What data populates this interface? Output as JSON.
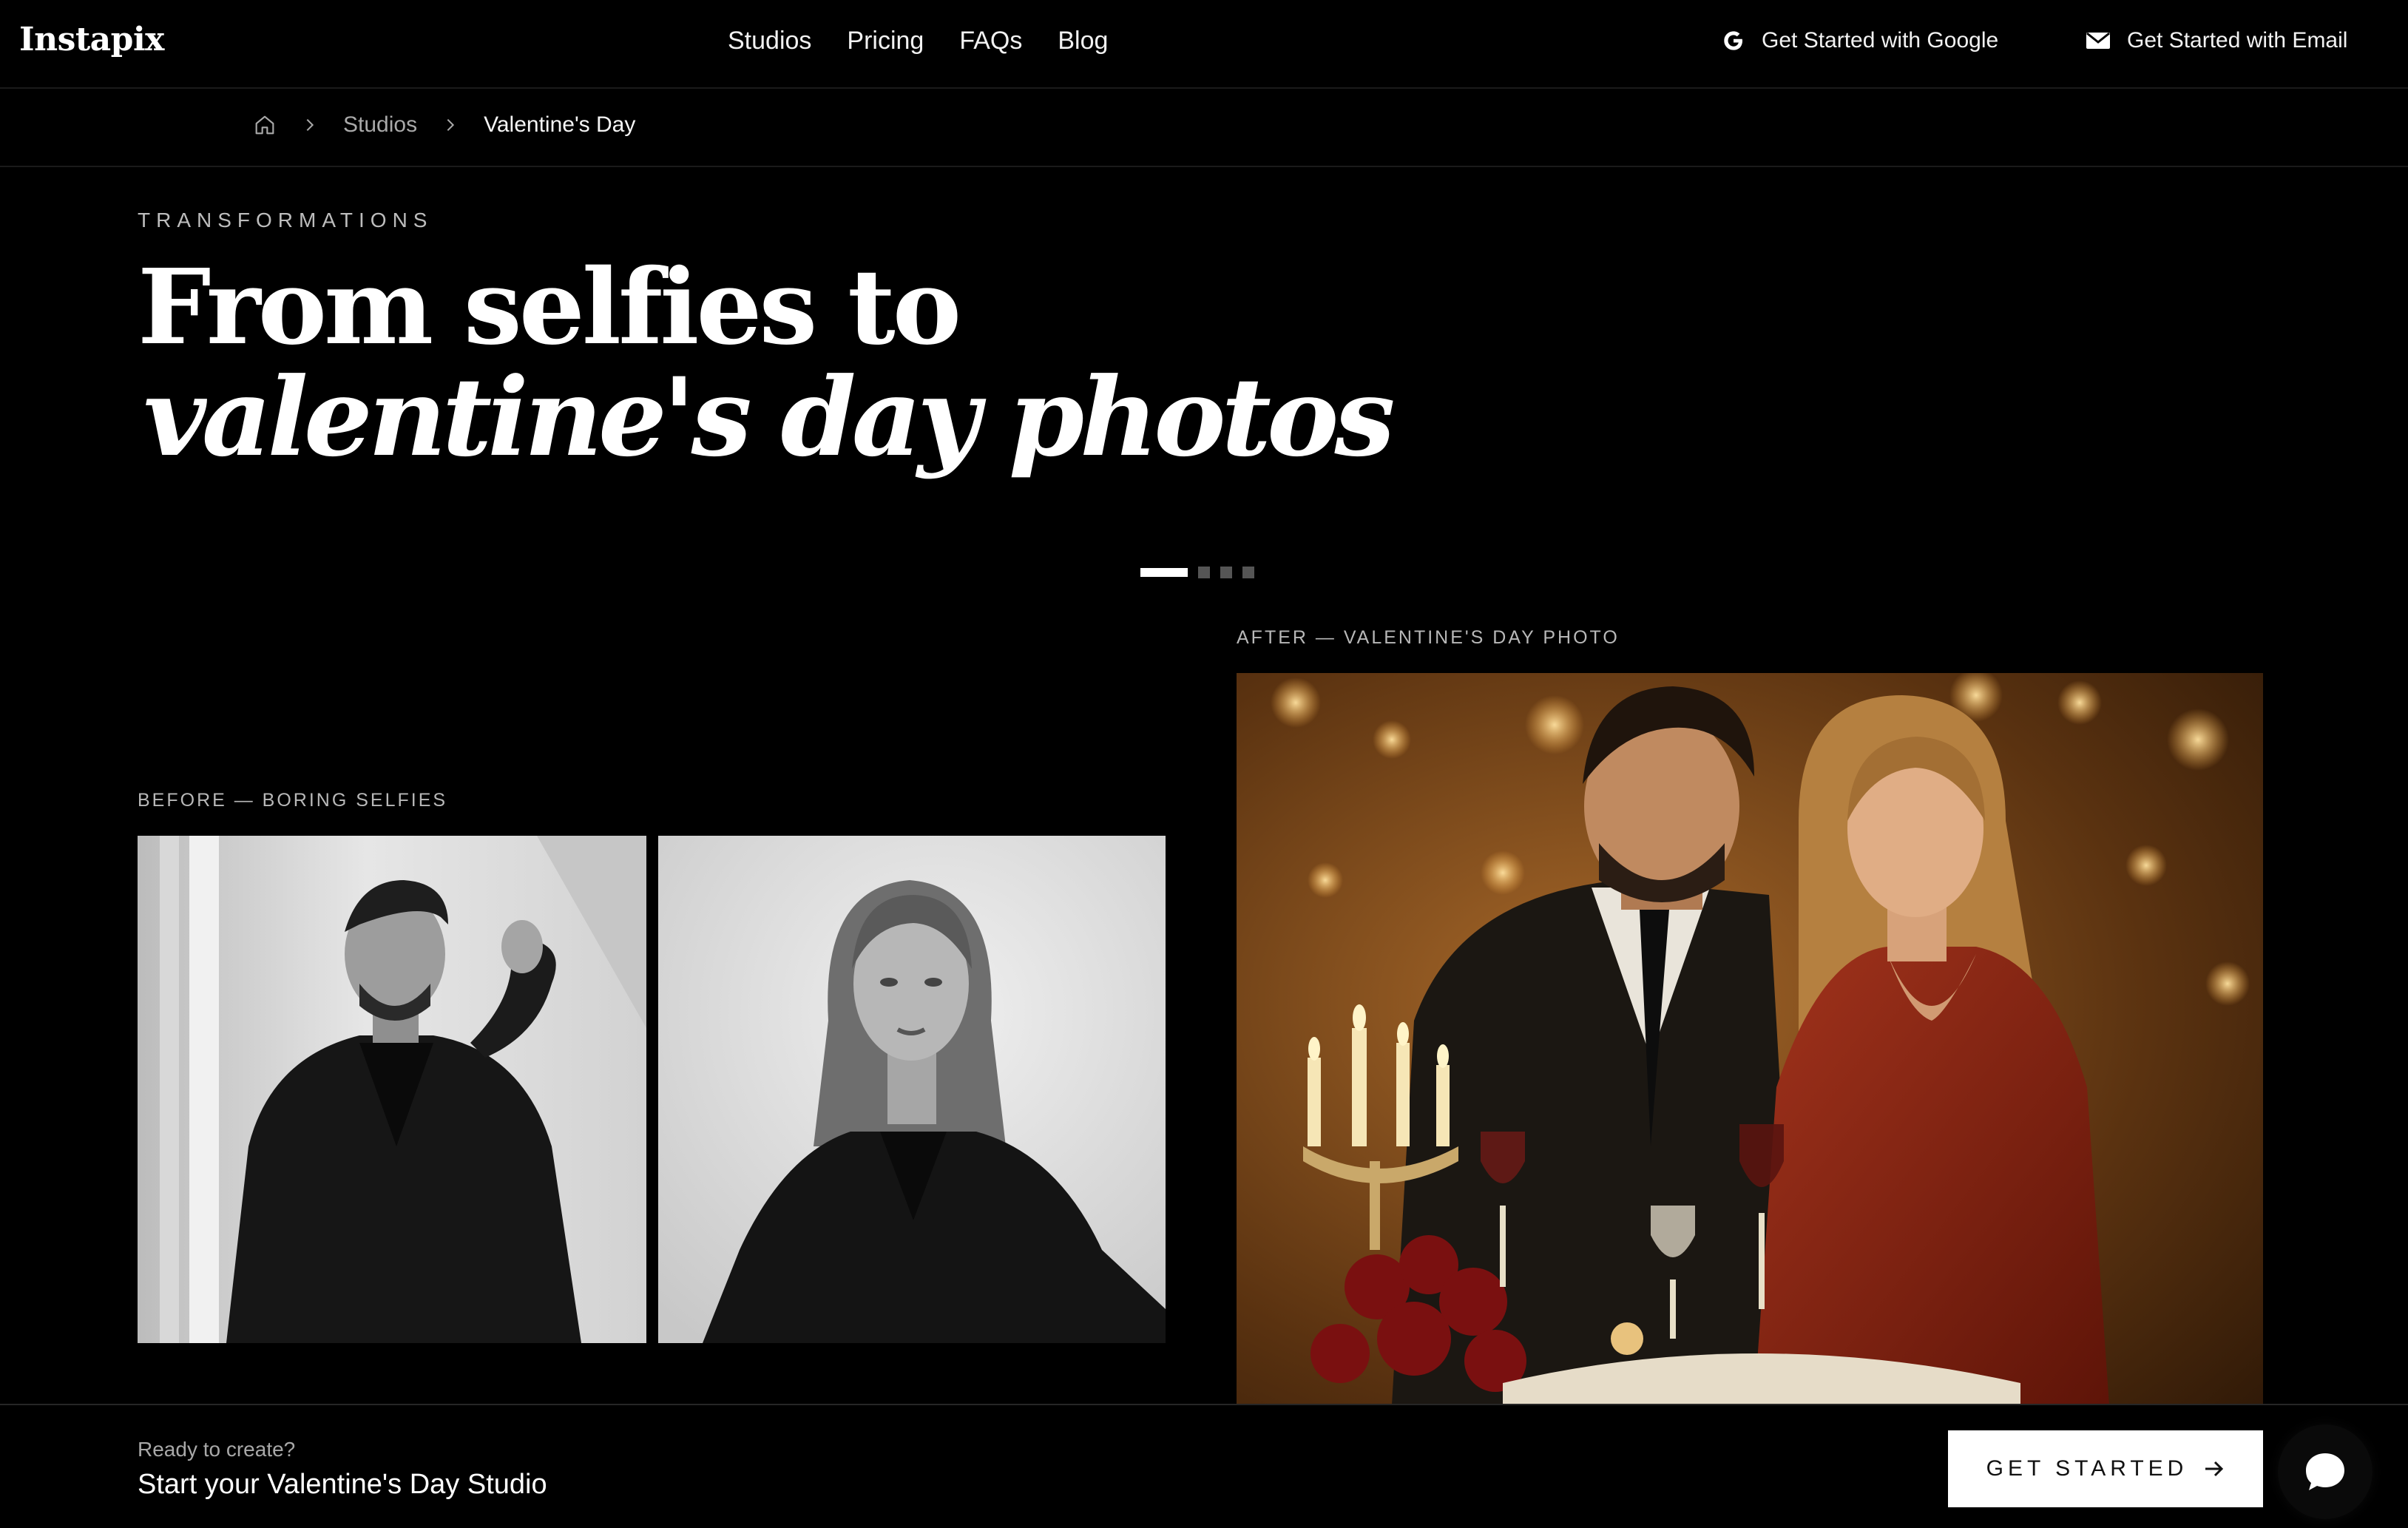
{
  "brand": {
    "logo": "Instapix"
  },
  "nav": {
    "links": [
      "Studios",
      "Pricing",
      "FAQs",
      "Blog"
    ],
    "cta_google": "Get Started with Google",
    "cta_email": "Get Started with Email"
  },
  "breadcrumb": {
    "home_icon": "home-icon",
    "studios": "Studios",
    "current": "Valentine's Day"
  },
  "hero": {
    "eyebrow": "TRANSFORMATIONS",
    "title_line1": "From selfies to",
    "title_line2": "valentine's day photos"
  },
  "carousel": {
    "slides": 4,
    "active_index": 0
  },
  "before": {
    "caption": "BEFORE — BORING SELFIES",
    "images": [
      "man-in-black-suit-selfie",
      "woman-in-black-blazer-selfie"
    ]
  },
  "after": {
    "caption": "AFTER — VALENTINE'S DAY PHOTO",
    "image": "couple-candlelit-dinner"
  },
  "footer_bar": {
    "ready": "Ready to create?",
    "studio_line": "Start your Valentine's Day Studio",
    "button_label": "GET STARTED",
    "button_icon": "arrow-right-icon",
    "chat_icon": "chat-bubble-icon"
  },
  "colors": {
    "background": "#000000",
    "text": "#ffffff",
    "muted": "#a8a8a8",
    "button_bg": "#ffffff"
  }
}
